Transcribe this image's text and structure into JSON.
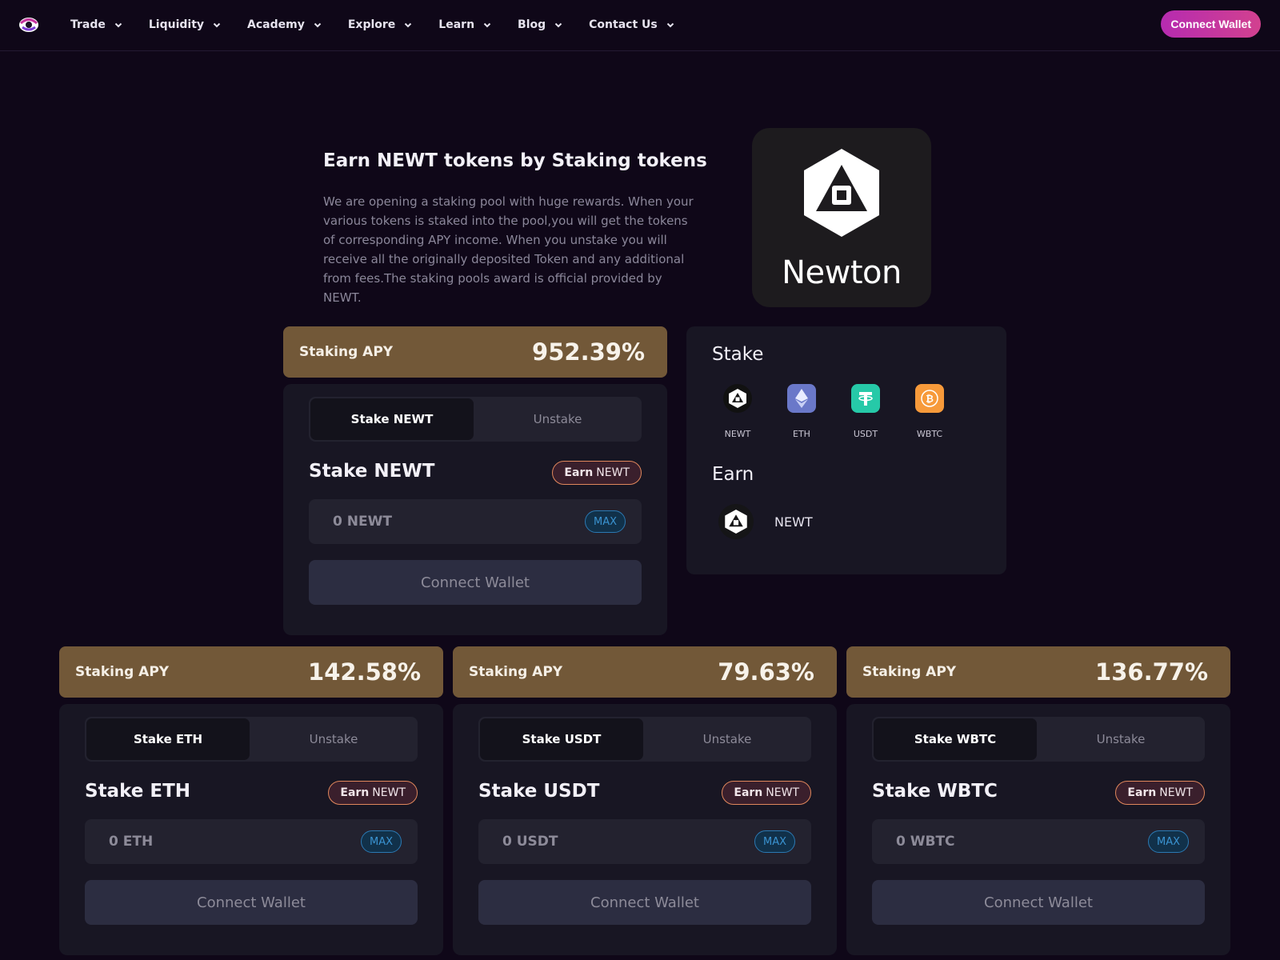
{
  "nav": {
    "menu": [
      {
        "label": "Trade"
      },
      {
        "label": "Liquidity"
      },
      {
        "label": "Academy"
      },
      {
        "label": "Explore"
      },
      {
        "label": "Learn"
      },
      {
        "label": "Blog"
      },
      {
        "label": "Contact Us"
      }
    ],
    "connect_label": "Connect Wallet"
  },
  "hero": {
    "title": "Earn NEWT tokens by Staking tokens",
    "description": "We are opening a staking pool with huge rewards. When your various tokens is staked into the pool,you will get the tokens of corresponding APY income. When you unstake you will receive all the originally deposited Token and any additional from fees.The staking pools award is official provided by NEWT.",
    "logo_text": "Newton"
  },
  "tokens_panel": {
    "stake_heading": "Stake",
    "earn_heading": "Earn",
    "stake_tokens": [
      {
        "symbol": "NEWT",
        "icon": "newt-icon",
        "color": "#111111"
      },
      {
        "symbol": "ETH",
        "icon": "eth-icon",
        "color": "#6a78c9"
      },
      {
        "symbol": "USDT",
        "icon": "usdt-icon",
        "color": "#26c9a8"
      },
      {
        "symbol": "WBTC",
        "icon": "wbtc-icon",
        "color": "#f79a3a"
      }
    ],
    "earn_token": {
      "symbol": "NEWT",
      "icon": "newt-icon"
    }
  },
  "pools": {
    "newt": {
      "apy_label": "Staking APY",
      "apy_value": "952.39%",
      "tab_stake": "Stake NEWT",
      "tab_unstake": "Unstake",
      "title": "Stake NEWT",
      "earn_bold": "Earn",
      "earn_token": "NEWT",
      "placeholder": "0 NEWT",
      "max": "MAX",
      "connect": "Connect Wallet"
    },
    "eth": {
      "apy_label": "Staking APY",
      "apy_value": "142.58%",
      "tab_stake": "Stake ETH",
      "tab_unstake": "Unstake",
      "title": "Stake ETH",
      "earn_bold": "Earn",
      "earn_token": "NEWT",
      "placeholder": "0 ETH",
      "max": "MAX",
      "connect": "Connect Wallet"
    },
    "usdt": {
      "apy_label": "Staking APY",
      "apy_value": "79.63%",
      "tab_stake": "Stake USDT",
      "tab_unstake": "Unstake",
      "title": "Stake USDT",
      "earn_bold": "Earn",
      "earn_token": "NEWT",
      "placeholder": "0 USDT",
      "max": "MAX",
      "connect": "Connect Wallet"
    },
    "wbtc": {
      "apy_label": "Staking APY",
      "apy_value": "136.77%",
      "tab_stake": "Stake WBTC",
      "tab_unstake": "Unstake",
      "title": "Stake WBTC",
      "earn_bold": "Earn",
      "earn_token": "NEWT",
      "placeholder": "0 WBTC",
      "max": "MAX",
      "connect": "Connect Wallet"
    }
  },
  "colors": {
    "background": "#0f0718",
    "card": "#181623",
    "apy_bar": "#725838",
    "accent": "#c6339f",
    "max": "#3a93d1"
  }
}
